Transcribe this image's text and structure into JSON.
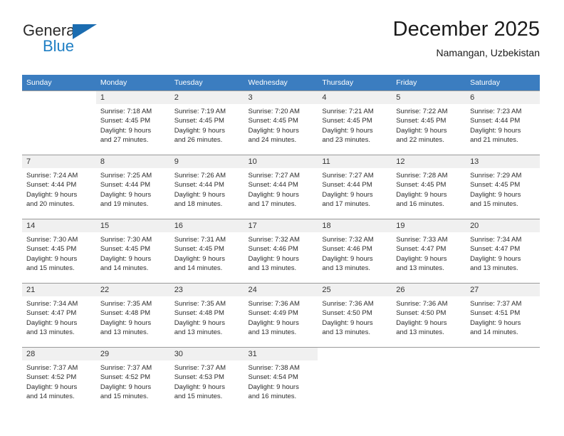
{
  "brand": {
    "word_one": "General",
    "word_two": "Blue",
    "flag_icon": "triangle-flag-icon",
    "accent_color": "#1b6cb0",
    "blue_text_color": "#1f7fc4"
  },
  "header": {
    "title": "December 2025",
    "subtitle": "Namangan, Uzbekistan"
  },
  "calendar": {
    "header_bg": "#3b7dc0",
    "daynum_bg": "#f0f0f0",
    "border_color": "#9a9a9a",
    "weekday_headers": [
      "Sunday",
      "Monday",
      "Tuesday",
      "Wednesday",
      "Thursday",
      "Friday",
      "Saturday"
    ],
    "weeks": [
      [
        {
          "day": "",
          "lines": []
        },
        {
          "day": "1",
          "lines": [
            "Sunrise: 7:18 AM",
            "Sunset: 4:45 PM",
            "Daylight: 9 hours",
            "and 27 minutes."
          ]
        },
        {
          "day": "2",
          "lines": [
            "Sunrise: 7:19 AM",
            "Sunset: 4:45 PM",
            "Daylight: 9 hours",
            "and 26 minutes."
          ]
        },
        {
          "day": "3",
          "lines": [
            "Sunrise: 7:20 AM",
            "Sunset: 4:45 PM",
            "Daylight: 9 hours",
            "and 24 minutes."
          ]
        },
        {
          "day": "4",
          "lines": [
            "Sunrise: 7:21 AM",
            "Sunset: 4:45 PM",
            "Daylight: 9 hours",
            "and 23 minutes."
          ]
        },
        {
          "day": "5",
          "lines": [
            "Sunrise: 7:22 AM",
            "Sunset: 4:45 PM",
            "Daylight: 9 hours",
            "and 22 minutes."
          ]
        },
        {
          "day": "6",
          "lines": [
            "Sunrise: 7:23 AM",
            "Sunset: 4:44 PM",
            "Daylight: 9 hours",
            "and 21 minutes."
          ]
        }
      ],
      [
        {
          "day": "7",
          "lines": [
            "Sunrise: 7:24 AM",
            "Sunset: 4:44 PM",
            "Daylight: 9 hours",
            "and 20 minutes."
          ]
        },
        {
          "day": "8",
          "lines": [
            "Sunrise: 7:25 AM",
            "Sunset: 4:44 PM",
            "Daylight: 9 hours",
            "and 19 minutes."
          ]
        },
        {
          "day": "9",
          "lines": [
            "Sunrise: 7:26 AM",
            "Sunset: 4:44 PM",
            "Daylight: 9 hours",
            "and 18 minutes."
          ]
        },
        {
          "day": "10",
          "lines": [
            "Sunrise: 7:27 AM",
            "Sunset: 4:44 PM",
            "Daylight: 9 hours",
            "and 17 minutes."
          ]
        },
        {
          "day": "11",
          "lines": [
            "Sunrise: 7:27 AM",
            "Sunset: 4:44 PM",
            "Daylight: 9 hours",
            "and 17 minutes."
          ]
        },
        {
          "day": "12",
          "lines": [
            "Sunrise: 7:28 AM",
            "Sunset: 4:45 PM",
            "Daylight: 9 hours",
            "and 16 minutes."
          ]
        },
        {
          "day": "13",
          "lines": [
            "Sunrise: 7:29 AM",
            "Sunset: 4:45 PM",
            "Daylight: 9 hours",
            "and 15 minutes."
          ]
        }
      ],
      [
        {
          "day": "14",
          "lines": [
            "Sunrise: 7:30 AM",
            "Sunset: 4:45 PM",
            "Daylight: 9 hours",
            "and 15 minutes."
          ]
        },
        {
          "day": "15",
          "lines": [
            "Sunrise: 7:30 AM",
            "Sunset: 4:45 PM",
            "Daylight: 9 hours",
            "and 14 minutes."
          ]
        },
        {
          "day": "16",
          "lines": [
            "Sunrise: 7:31 AM",
            "Sunset: 4:45 PM",
            "Daylight: 9 hours",
            "and 14 minutes."
          ]
        },
        {
          "day": "17",
          "lines": [
            "Sunrise: 7:32 AM",
            "Sunset: 4:46 PM",
            "Daylight: 9 hours",
            "and 13 minutes."
          ]
        },
        {
          "day": "18",
          "lines": [
            "Sunrise: 7:32 AM",
            "Sunset: 4:46 PM",
            "Daylight: 9 hours",
            "and 13 minutes."
          ]
        },
        {
          "day": "19",
          "lines": [
            "Sunrise: 7:33 AM",
            "Sunset: 4:47 PM",
            "Daylight: 9 hours",
            "and 13 minutes."
          ]
        },
        {
          "day": "20",
          "lines": [
            "Sunrise: 7:34 AM",
            "Sunset: 4:47 PM",
            "Daylight: 9 hours",
            "and 13 minutes."
          ]
        }
      ],
      [
        {
          "day": "21",
          "lines": [
            "Sunrise: 7:34 AM",
            "Sunset: 4:47 PM",
            "Daylight: 9 hours",
            "and 13 minutes."
          ]
        },
        {
          "day": "22",
          "lines": [
            "Sunrise: 7:35 AM",
            "Sunset: 4:48 PM",
            "Daylight: 9 hours",
            "and 13 minutes."
          ]
        },
        {
          "day": "23",
          "lines": [
            "Sunrise: 7:35 AM",
            "Sunset: 4:48 PM",
            "Daylight: 9 hours",
            "and 13 minutes."
          ]
        },
        {
          "day": "24",
          "lines": [
            "Sunrise: 7:36 AM",
            "Sunset: 4:49 PM",
            "Daylight: 9 hours",
            "and 13 minutes."
          ]
        },
        {
          "day": "25",
          "lines": [
            "Sunrise: 7:36 AM",
            "Sunset: 4:50 PM",
            "Daylight: 9 hours",
            "and 13 minutes."
          ]
        },
        {
          "day": "26",
          "lines": [
            "Sunrise: 7:36 AM",
            "Sunset: 4:50 PM",
            "Daylight: 9 hours",
            "and 13 minutes."
          ]
        },
        {
          "day": "27",
          "lines": [
            "Sunrise: 7:37 AM",
            "Sunset: 4:51 PM",
            "Daylight: 9 hours",
            "and 14 minutes."
          ]
        }
      ],
      [
        {
          "day": "28",
          "lines": [
            "Sunrise: 7:37 AM",
            "Sunset: 4:52 PM",
            "Daylight: 9 hours",
            "and 14 minutes."
          ]
        },
        {
          "day": "29",
          "lines": [
            "Sunrise: 7:37 AM",
            "Sunset: 4:52 PM",
            "Daylight: 9 hours",
            "and 15 minutes."
          ]
        },
        {
          "day": "30",
          "lines": [
            "Sunrise: 7:37 AM",
            "Sunset: 4:53 PM",
            "Daylight: 9 hours",
            "and 15 minutes."
          ]
        },
        {
          "day": "31",
          "lines": [
            "Sunrise: 7:38 AM",
            "Sunset: 4:54 PM",
            "Daylight: 9 hours",
            "and 16 minutes."
          ]
        },
        {
          "day": "",
          "lines": []
        },
        {
          "day": "",
          "lines": []
        },
        {
          "day": "",
          "lines": []
        }
      ]
    ]
  }
}
